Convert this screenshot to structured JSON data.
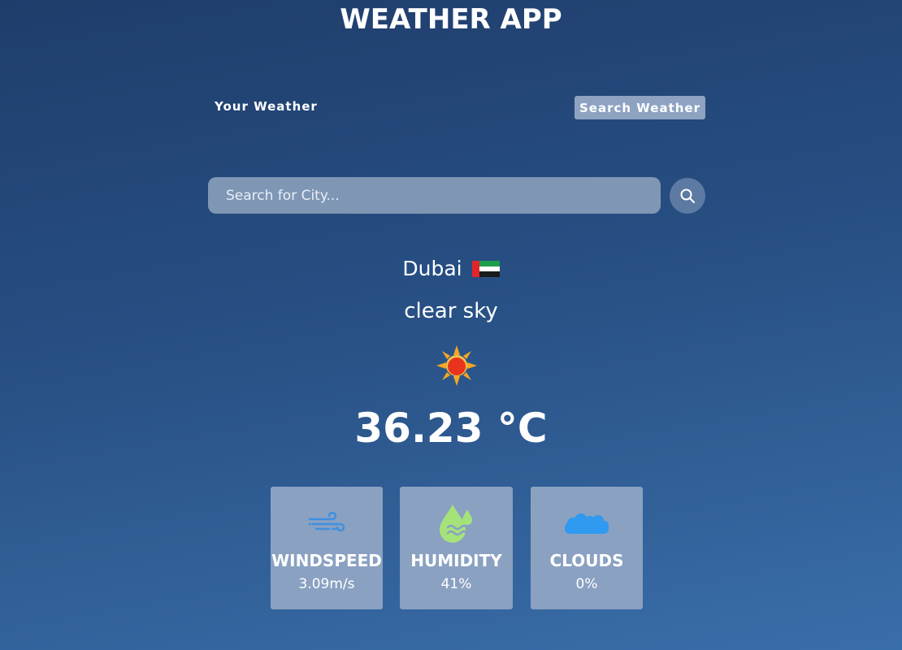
{
  "app": {
    "title": "WEATHER APP"
  },
  "tabs": {
    "your_weather": "Your Weather",
    "search_weather": "Search Weather"
  },
  "search": {
    "placeholder": "Search for City..."
  },
  "weather": {
    "city": "Dubai",
    "country_flag": "UAE flag",
    "description": "clear sky",
    "icon": "sun-icon",
    "temperature": "36.23 °C"
  },
  "stats": {
    "windspeed": {
      "label": "WINDSPEED",
      "value": "3.09m/s",
      "icon": "wind-icon"
    },
    "humidity": {
      "label": "HUMIDITY",
      "value": "41%",
      "icon": "humidity-icon"
    },
    "clouds": {
      "label": "CLOUDS",
      "value": "0%",
      "icon": "cloud-icon"
    }
  },
  "colors": {
    "background_top": "#1f3d6b",
    "background_bottom": "#3a6ea9",
    "card": "#8aa1c2",
    "search_field": "#7f97b5",
    "wind_icon": "#3f8fe0",
    "humidity_icon": "#a5e37a",
    "cloud_icon": "#2f9af0"
  }
}
